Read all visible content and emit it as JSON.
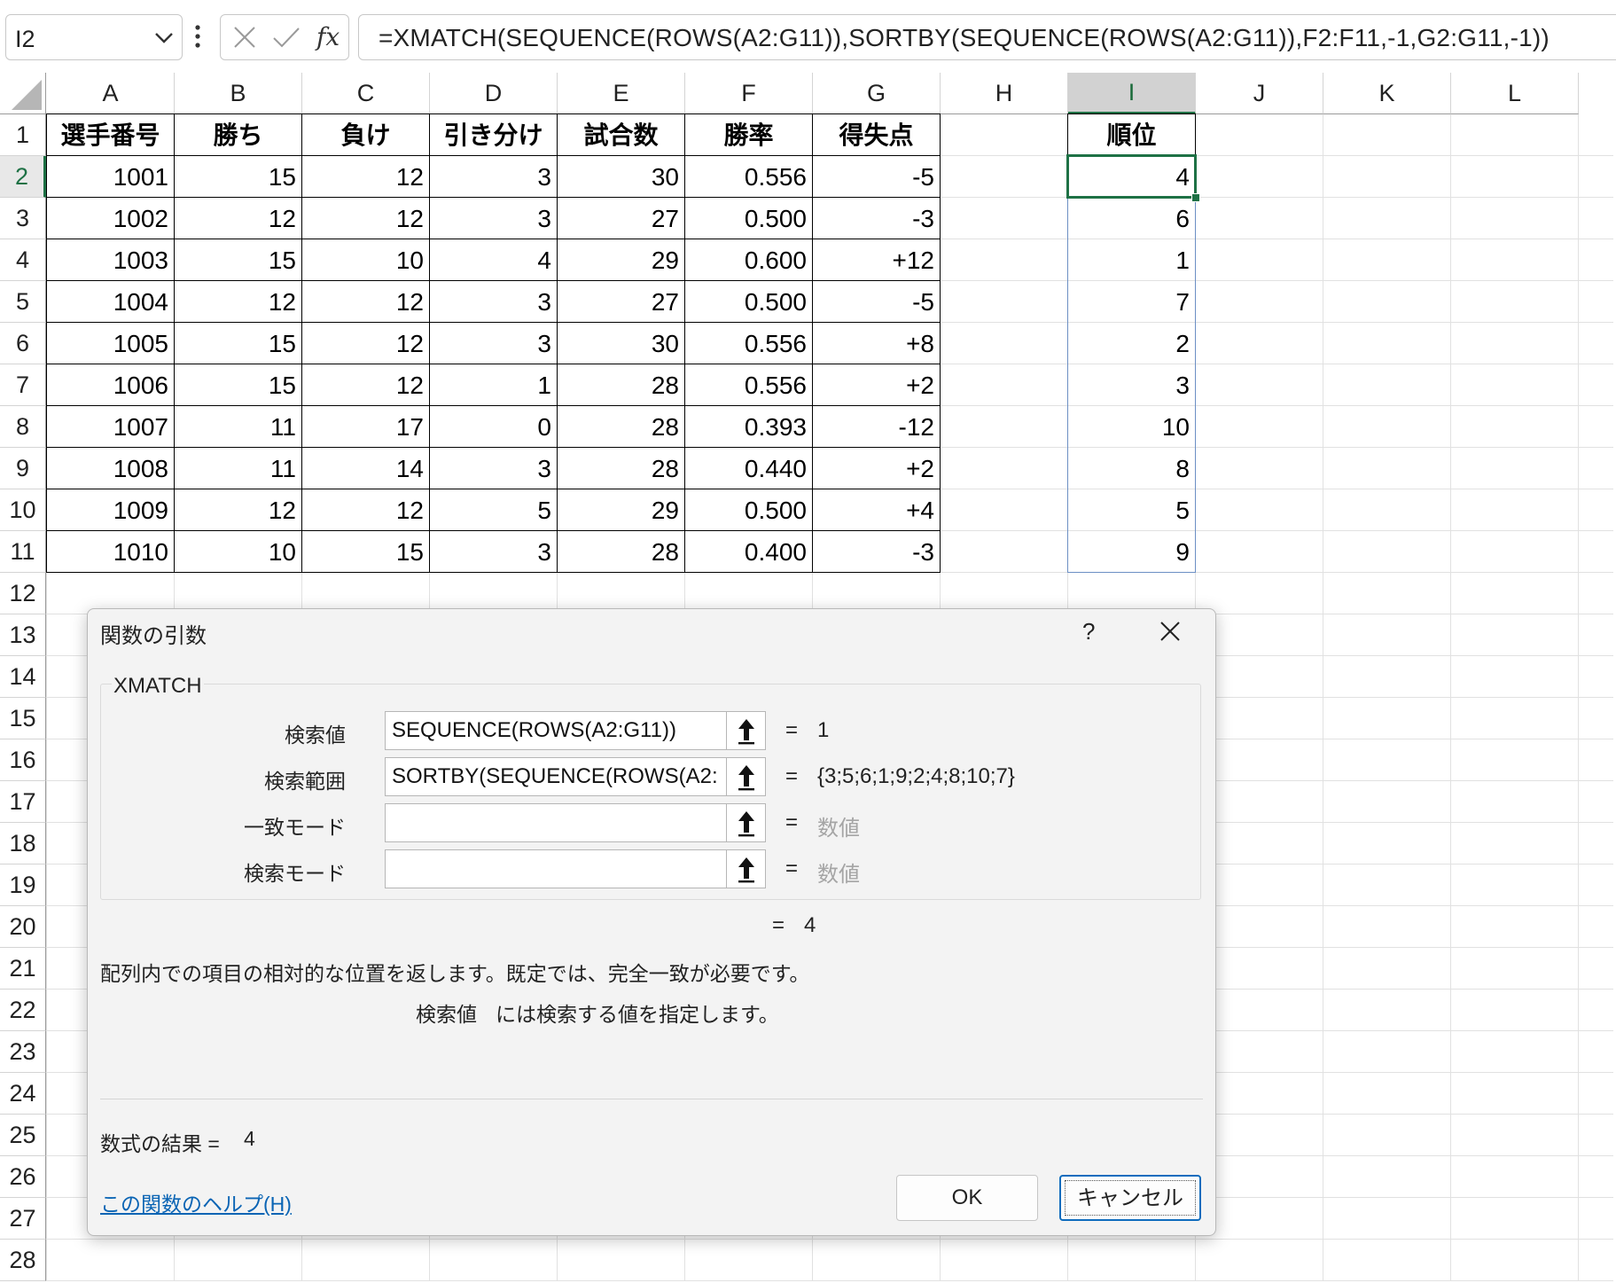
{
  "formula_bar": {
    "name_box": "I2",
    "formula": "=XMATCH(SEQUENCE(ROWS(A2:G11)),SORTBY(SEQUENCE(ROWS(A2:G11)),F2:F11,-1,G2:G11,-1))"
  },
  "sheet": {
    "columns": [
      "A",
      "B",
      "C",
      "D",
      "E",
      "F",
      "G",
      "H",
      "I",
      "J",
      "K",
      "L"
    ],
    "rows": [
      "1",
      "2",
      "3",
      "4",
      "5",
      "6",
      "7",
      "8",
      "9",
      "10",
      "11",
      "12",
      "13",
      "14",
      "15",
      "16",
      "17",
      "18",
      "19",
      "20",
      "21",
      "22",
      "23",
      "24",
      "25",
      "26",
      "27",
      "28"
    ],
    "selected_column": "I",
    "selected_row": "2",
    "table_headers": [
      "選手番号",
      "勝ち",
      "負け",
      "引き分け",
      "試合数",
      "勝率",
      "得失点"
    ],
    "table_rows": [
      [
        "1001",
        "15",
        "12",
        "3",
        "30",
        "0.556",
        "-5"
      ],
      [
        "1002",
        "12",
        "12",
        "3",
        "27",
        "0.500",
        "-3"
      ],
      [
        "1003",
        "15",
        "10",
        "4",
        "29",
        "0.600",
        "+12"
      ],
      [
        "1004",
        "12",
        "12",
        "3",
        "27",
        "0.500",
        "-5"
      ],
      [
        "1005",
        "15",
        "12",
        "3",
        "30",
        "0.556",
        "+8"
      ],
      [
        "1006",
        "15",
        "12",
        "1",
        "28",
        "0.556",
        "+2"
      ],
      [
        "1007",
        "11",
        "17",
        "0",
        "28",
        "0.393",
        "-12"
      ],
      [
        "1008",
        "11",
        "14",
        "3",
        "28",
        "0.440",
        "+2"
      ],
      [
        "1009",
        "12",
        "12",
        "5",
        "29",
        "0.500",
        "+4"
      ],
      [
        "1010",
        "10",
        "15",
        "3",
        "28",
        "0.400",
        "-3"
      ]
    ],
    "rank_header": "順位",
    "rank_values": [
      "4",
      "6",
      "1",
      "7",
      "2",
      "3",
      "10",
      "8",
      "5",
      "9"
    ]
  },
  "dialog": {
    "title": "関数の引数",
    "help_glyph": "?",
    "function_name": "XMATCH",
    "args": [
      {
        "label": "検索値",
        "value": "SEQUENCE(ROWS(A2:G11))",
        "result": "1",
        "placeholder": false
      },
      {
        "label": "検索範囲",
        "value": "SORTBY(SEQUENCE(ROWS(A2:",
        "result": "{3;5;6;1;9;2;4;8;10;7}",
        "placeholder": false
      },
      {
        "label": "一致モード",
        "value": "",
        "result": "数値",
        "placeholder": true
      },
      {
        "label": "検索モード",
        "value": "",
        "result": "数値",
        "placeholder": true
      }
    ],
    "equals": "=",
    "summary_result": "4",
    "description": "配列内での項目の相対的な位置を返します。既定では、完全一致が必要です。",
    "arg_name": "検索値",
    "arg_description": "には検索する値を指定します。",
    "formula_result_label": "数式の結果 =",
    "formula_result_value": "4",
    "help_link": "この関数のヘルプ(H)",
    "ok_label": "OK",
    "cancel_label": "キャンセル"
  },
  "colors": {
    "accent_green": "#1e7145",
    "link_blue": "#0a64b4",
    "selection_blue": "#6c8fc4"
  }
}
